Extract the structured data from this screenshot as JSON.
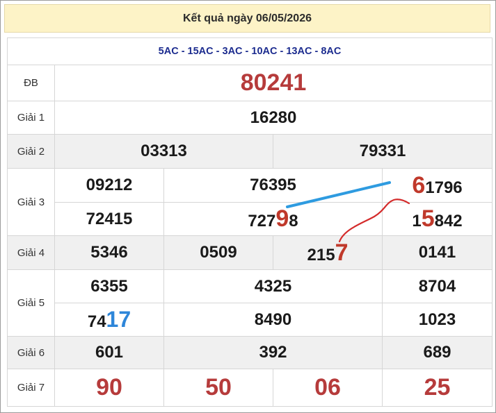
{
  "title": "Kết quả ngày 06/05/2026",
  "codes": "5AC - 15AC - 3AC - 10AC - 13AC - 8AC",
  "labels": {
    "db": "ĐB",
    "g1": "Giải 1",
    "g2": "Giải 2",
    "g3": "Giải 3",
    "g4": "Giải 4",
    "g5": "Giải 5",
    "g6": "Giải 6",
    "g7": "Giải 7"
  },
  "db": "80241",
  "g1": "16280",
  "g2": [
    "03313",
    "79331"
  ],
  "g3": {
    "a": "09212",
    "b": "76395",
    "c_hl": "6",
    "c_rest": "1796",
    "d": "72415",
    "e_pre": "727",
    "e_hl": "9",
    "e_post": "8",
    "f_pre": "1",
    "f_hl": "5",
    "f_post": "842"
  },
  "g4": {
    "a": "5346",
    "b": "0509",
    "c_pre": "215",
    "c_hl": "7",
    "d": "0141"
  },
  "g5": {
    "a": "6355",
    "b": "4325",
    "c": "8704",
    "d_pre": "74",
    "d_hl": "17",
    "e": "8490",
    "f": "1023"
  },
  "g6": [
    "601",
    "392",
    "689"
  ],
  "g7": [
    "90",
    "50",
    "06",
    "25"
  ],
  "colors": {
    "header_bg": "#fdf3c7",
    "red": "#b63b3b",
    "blue": "#2e86d9",
    "code_blue": "#1c2c8f"
  }
}
